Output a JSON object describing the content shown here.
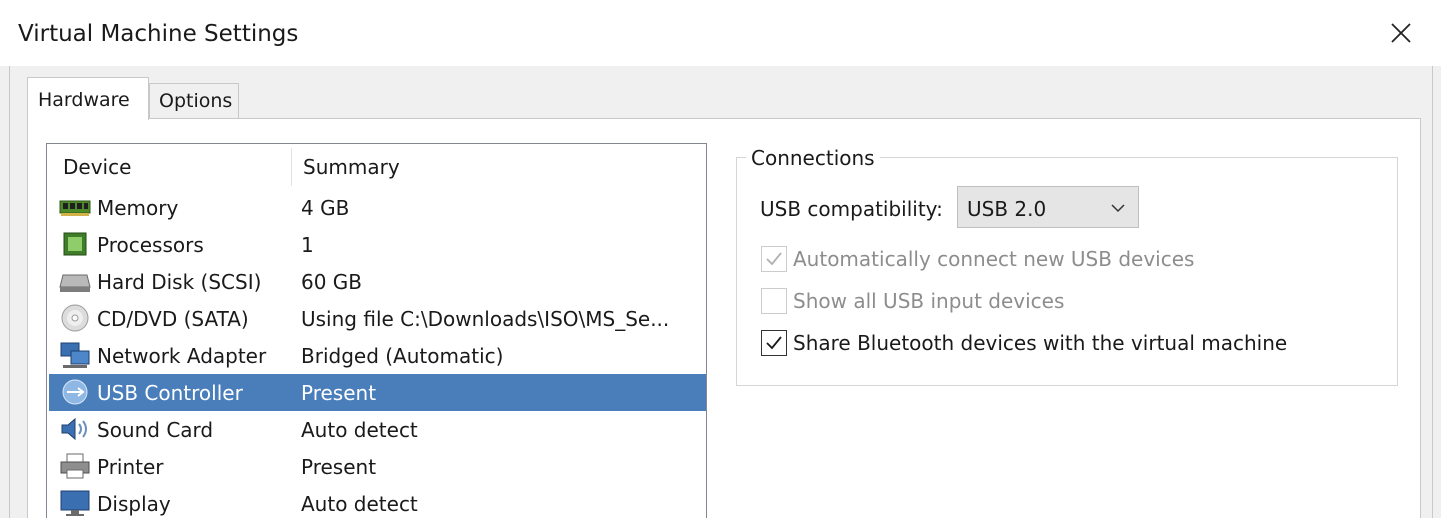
{
  "window": {
    "title": "Virtual Machine Settings",
    "close_icon": "close-icon"
  },
  "tabs": [
    {
      "label": "Hardware",
      "active": true
    },
    {
      "label": "Options",
      "active": false
    }
  ],
  "device_list": {
    "headers": {
      "device": "Device",
      "summary": "Summary"
    },
    "rows": [
      {
        "icon": "memory-icon",
        "device": "Memory",
        "summary": "4 GB",
        "selected": false
      },
      {
        "icon": "processor-icon",
        "device": "Processors",
        "summary": "1",
        "selected": false
      },
      {
        "icon": "hard-disk-icon",
        "device": "Hard Disk (SCSI)",
        "summary": "60 GB",
        "selected": false
      },
      {
        "icon": "cd-dvd-icon",
        "device": "CD/DVD (SATA)",
        "summary": "Using file C:\\Downloads\\ISO\\MS_Se...",
        "selected": false
      },
      {
        "icon": "network-adapter-icon",
        "device": "Network Adapter",
        "summary": "Bridged (Automatic)",
        "selected": false
      },
      {
        "icon": "usb-icon",
        "device": "USB Controller",
        "summary": "Present",
        "selected": true
      },
      {
        "icon": "sound-card-icon",
        "device": "Sound Card",
        "summary": "Auto detect",
        "selected": false
      },
      {
        "icon": "printer-icon",
        "device": "Printer",
        "summary": "Present",
        "selected": false
      },
      {
        "icon": "display-icon",
        "device": "Display",
        "summary": "Auto detect",
        "selected": false
      }
    ]
  },
  "connections": {
    "title": "Connections",
    "usb_compat_label": "USB compatibility:",
    "usb_compat_value": "USB 2.0",
    "checkboxes": [
      {
        "label": "Automatically connect new USB devices",
        "checked": true,
        "enabled": false
      },
      {
        "label": "Show all USB input devices",
        "checked": false,
        "enabled": false
      },
      {
        "label": "Share Bluetooth devices with the virtual machine",
        "checked": true,
        "enabled": true
      }
    ]
  },
  "colors": {
    "selection": "#4a7ebb",
    "window_bg": "#f0f0f0"
  }
}
